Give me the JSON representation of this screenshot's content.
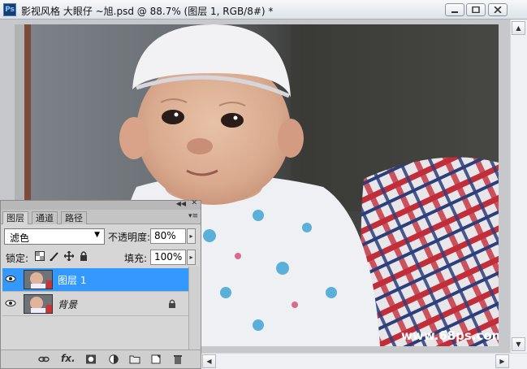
{
  "window": {
    "title": "影视风格 大眼仔 ~旭.psd @ 88.7% (图层 1, RGB/8#) *",
    "logo_text": "Ps"
  },
  "watermark": "www.68ps.com",
  "layers_panel": {
    "tabs": [
      {
        "label": "图层",
        "active": true
      },
      {
        "label": "通道",
        "active": false
      },
      {
        "label": "路径",
        "active": false
      }
    ],
    "blend_mode": "滤色",
    "opacity_label": "不透明度:",
    "opacity_value": "80%",
    "lock_label": "锁定:",
    "fill_label": "填充:",
    "fill_value": "100%",
    "layers": [
      {
        "name": "图层 1",
        "selected": true,
        "visible": true,
        "locked": false
      },
      {
        "name": "背景",
        "selected": false,
        "visible": true,
        "locked": true
      }
    ],
    "bottom_icons": [
      "link-icon",
      "fx-icon",
      "mask-icon",
      "adjustment-icon",
      "group-folder-icon",
      "new-layer-icon",
      "trash-icon"
    ],
    "fx_label": "fx."
  },
  "colors": {
    "selected_layer": "#3399ff",
    "title_gradient_top": "#f6f7f9"
  }
}
